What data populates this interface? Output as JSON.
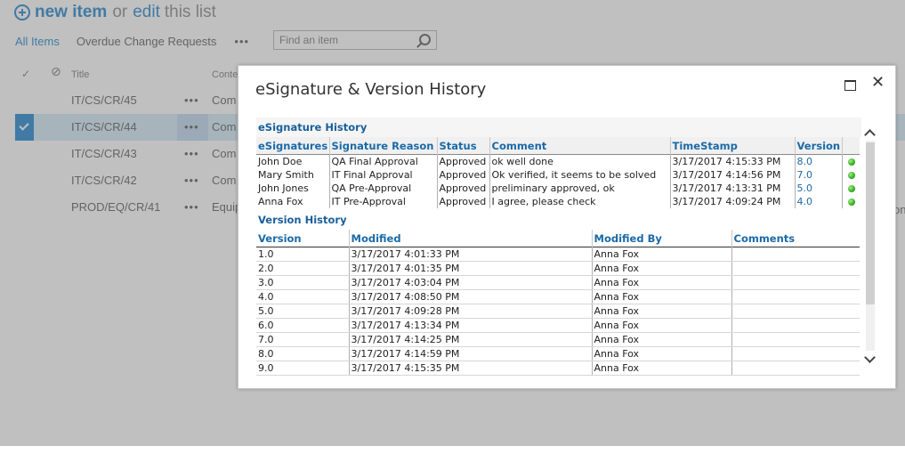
{
  "header": {
    "new_item": "new item",
    "or": "or",
    "edit": "edit",
    "this_list": "this list"
  },
  "views": {
    "all_items": "All Items",
    "overdue": "Overdue Change Requests",
    "more": "•••"
  },
  "search": {
    "placeholder": "Find an item"
  },
  "list": {
    "columns": {
      "title": "Title",
      "content": "Conte"
    },
    "rows": [
      {
        "title": "IT/CS/CR/45",
        "content": "Com",
        "selected": false
      },
      {
        "title": "IT/CS/CR/44",
        "content": "Com",
        "selected": true
      },
      {
        "title": "IT/CS/CR/43",
        "content": "Com",
        "selected": false
      },
      {
        "title": "IT/CS/CR/42",
        "content": "Com",
        "selected": false
      },
      {
        "title": "PROD/EQ/CR/41",
        "content": "Equip",
        "selected": false
      }
    ],
    "row_dots": "•••",
    "right_clip": "on"
  },
  "dialog": {
    "title": "eSignature & Version History",
    "esig_section": "eSignature History",
    "esig_columns": [
      "eSignatures",
      "Signature Reason",
      "Status",
      "Comment",
      "TimeStamp",
      "Version"
    ],
    "esig_rows": [
      {
        "name": "John Doe",
        "reason": "QA Final Approval",
        "status": "Approved",
        "comment": "ok well done",
        "timestamp": "3/17/2017 4:15:33 PM",
        "version": "8.0"
      },
      {
        "name": "Mary Smith",
        "reason": "IT Final Approval",
        "status": "Approved",
        "comment": "Ok verified, it seems to be solved",
        "timestamp": "3/17/2017 4:14:56 PM",
        "version": "7.0"
      },
      {
        "name": "John Jones",
        "reason": "QA Pre-Approval",
        "status": "Approved",
        "comment": "preliminary approved, ok",
        "timestamp": "3/17/2017 4:13:31 PM",
        "version": "5.0"
      },
      {
        "name": "Anna Fox",
        "reason": "IT Pre-Approval",
        "status": "Approved",
        "comment": "I agree, please check",
        "timestamp": "3/17/2017 4:09:24 PM",
        "version": "4.0"
      }
    ],
    "status_color": "#27a01c",
    "version_section": "Version History",
    "version_columns": [
      "Version",
      "Modified",
      "Modified By",
      "Comments"
    ],
    "version_rows": [
      {
        "version": "1.0",
        "modified": "3/17/2017 4:01:33 PM",
        "by": "Anna Fox",
        "comments": ""
      },
      {
        "version": "2.0",
        "modified": "3/17/2017 4:01:35 PM",
        "by": "Anna Fox",
        "comments": ""
      },
      {
        "version": "3.0",
        "modified": "3/17/2017 4:03:04 PM",
        "by": "Anna Fox",
        "comments": ""
      },
      {
        "version": "4.0",
        "modified": "3/17/2017 4:08:50 PM",
        "by": "Anna Fox",
        "comments": ""
      },
      {
        "version": "5.0",
        "modified": "3/17/2017 4:09:28 PM",
        "by": "Anna Fox",
        "comments": ""
      },
      {
        "version": "6.0",
        "modified": "3/17/2017 4:13:34 PM",
        "by": "Anna Fox",
        "comments": ""
      },
      {
        "version": "7.0",
        "modified": "3/17/2017 4:14:25 PM",
        "by": "Anna Fox",
        "comments": ""
      },
      {
        "version": "8.0",
        "modified": "3/17/2017 4:14:59 PM",
        "by": "Anna Fox",
        "comments": ""
      },
      {
        "version": "9.0",
        "modified": "3/17/2017 4:15:35 PM",
        "by": "Anna Fox",
        "comments": ""
      }
    ]
  }
}
